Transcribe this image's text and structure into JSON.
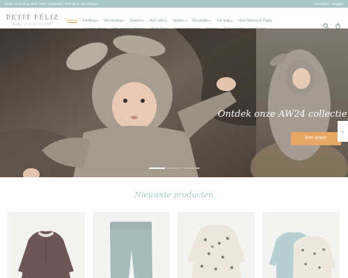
{
  "topbar": {
    "promo": "Gratis verzending vanaf 100€ | Cadeautje? Meld dit bij opmerkingen.",
    "account": "Aanmelden / Inloggen"
  },
  "logo": {
    "name": "PETIT FÉLIZ",
    "tagline": "BABY & KIDS STORE"
  },
  "nav": {
    "row1": [
      {
        "label": "Home",
        "dropdown": false
      },
      {
        "label": "Kleding",
        "dropdown": true
      },
      {
        "label": "Verzorging",
        "dropdown": true
      },
      {
        "label": "Slapen",
        "dropdown": true
      },
      {
        "label": "Aan tafel",
        "dropdown": true
      },
      {
        "label": "Spelen",
        "dropdown": true
      },
      {
        "label": "Decoratie",
        "dropdown": true
      },
      {
        "label": "Op stap",
        "dropdown": true
      },
      {
        "label": "Voor Mama & Papa",
        "dropdown": false
      }
    ],
    "row2": [
      {
        "label": "Laatste stuks"
      },
      {
        "label": "Info geboortelijsten"
      },
      {
        "label": "Petit Rent"
      },
      {
        "label": "Cadeaubonnen"
      },
      {
        "label": "Merken"
      },
      {
        "label": "Geboortelijst raadplegen"
      }
    ],
    "caret": "▾",
    "active_color": "#e0a35a"
  },
  "icons": [
    "search-icon",
    "cart-icon"
  ],
  "hero": {
    "caption": "Ontdek onze AW24 collectie",
    "cta": "Brrrr winter!",
    "next": "›",
    "slides": 3,
    "active_slide": 1
  },
  "section": {
    "title": "Nieuwste producten"
  },
  "products": [
    {
      "image": "mauve-baby-shirt"
    },
    {
      "image": "sage-knit-leggings"
    },
    {
      "image": "printed-baby-romper"
    },
    {
      "image": "blue-and-printed-romper-set"
    }
  ],
  "colors": {
    "topbar": "#a9c7c9",
    "accent": "#e5a763",
    "section_title": "#a9c7c9"
  }
}
